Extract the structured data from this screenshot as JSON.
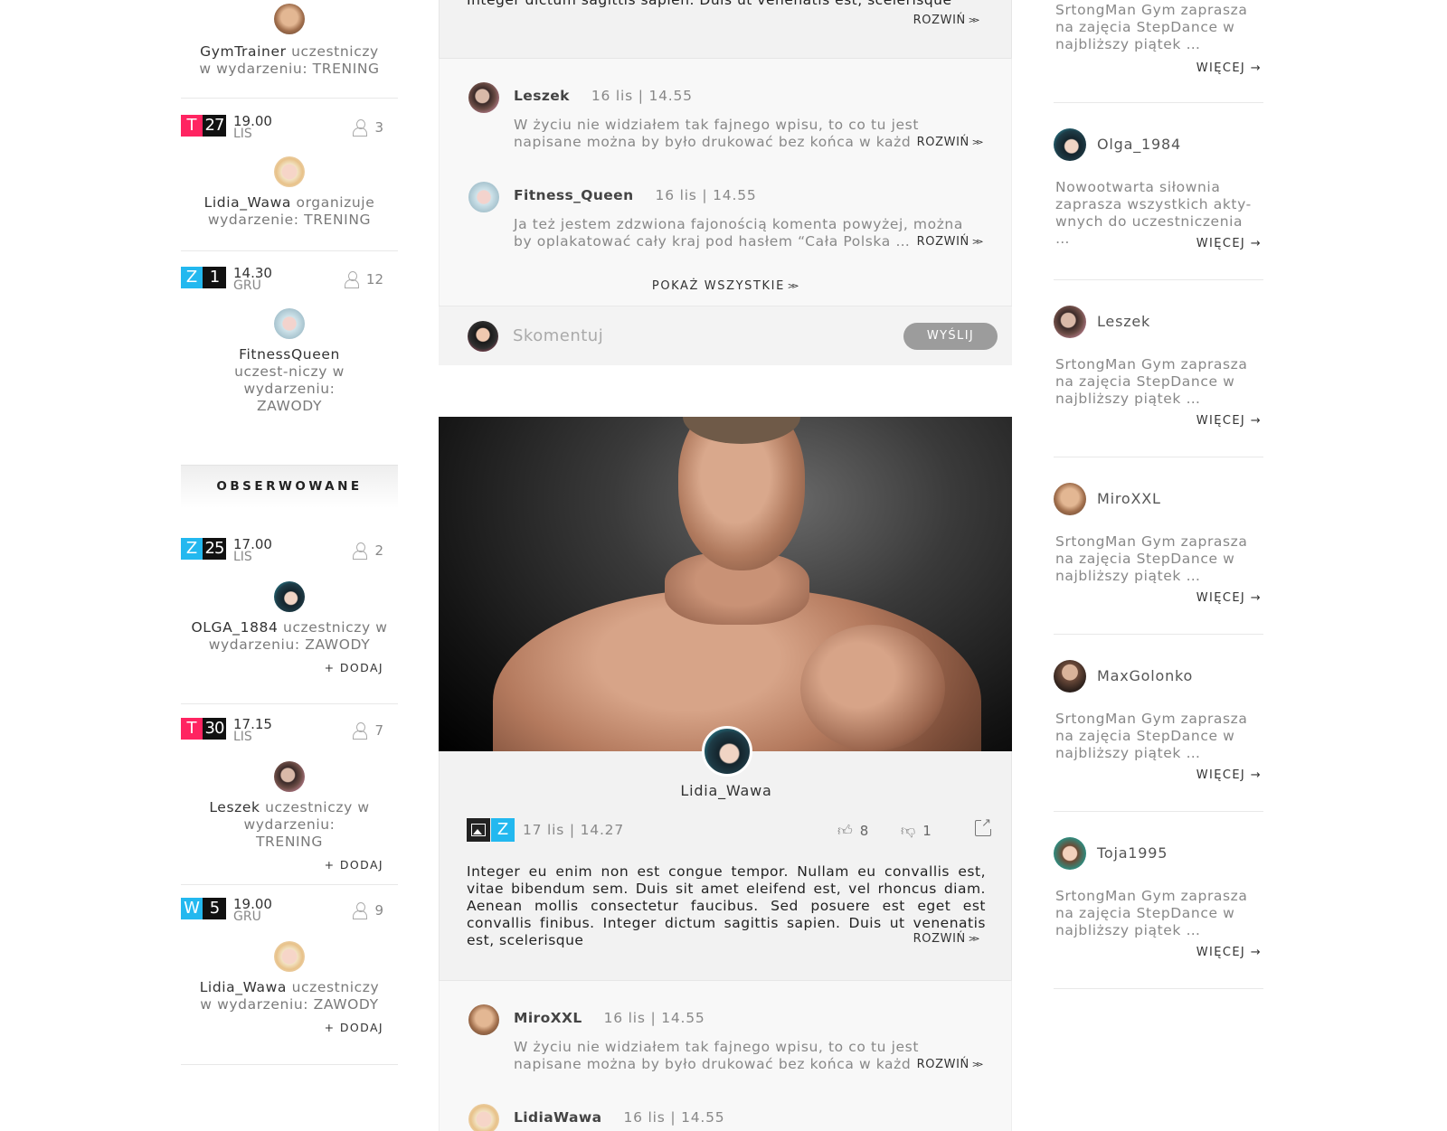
{
  "left": {
    "top_activity": {
      "user": "GymTrainer",
      "text": "uczestniczy w wydarzeniu: TRENING"
    },
    "events": [
      {
        "letter": "T",
        "day": "27",
        "time": "19.00",
        "month": "LIS",
        "count": "3",
        "user": "Lidia_Wawa",
        "text": "organizuje wydarzenie: TRENING"
      },
      {
        "letter": "Z",
        "day": "1",
        "time": "14.30",
        "month": "GRU",
        "count": "12",
        "user": "FitnessQueen",
        "text": "uczest-niczy w wydarzeniu: ZAWODY"
      }
    ],
    "observed_title": "OBSERWOWANE",
    "observed": [
      {
        "letter": "Z",
        "day": "25",
        "time": "17.00",
        "month": "LIS",
        "count": "2",
        "user": "OLGA_1884",
        "text": "uczestniczy w wydarzeniu: ZAWODY",
        "add": "+ DODAJ"
      },
      {
        "letter": "T",
        "day": "30",
        "time": "17.15",
        "month": "LIS",
        "count": "7",
        "user": "Leszek",
        "text": "uczestniczy w wydarzeniu: TRENING",
        "add": "+ DODAJ"
      },
      {
        "letter": "W",
        "day": "5",
        "time": "19.00",
        "month": "GRU",
        "count": "9",
        "user": "Lidia_Wawa",
        "text": "uczestniczy w wydarzeniu: ZAWODY",
        "add": "+ DODAJ"
      }
    ]
  },
  "post1": {
    "text_tail": "Integer dictum sagittis sapien. Duis ut venenatis est, scelerisque",
    "expand": "ROZWIŃ",
    "comments": [
      {
        "user": "Leszek",
        "date": "16 lis | 14.55",
        "text": "W życiu nie widziałem tak fajnego wpisu, to co tu jest napisane można by było drukować bez końca w każdej  …",
        "expand": "ROZWIŃ"
      },
      {
        "user": "Fitness_Queen",
        "date": "16 lis | 14.55",
        "text": "Ja też jestem zdzwiona fajonością komenta powyżej, można by oplakatować cały kraj pod hasłem “Cała Polska …",
        "expand": "ROZWIŃ"
      }
    ],
    "show_all": "POKAŻ WSZYSTKIE",
    "comment_placeholder": "Skomentuj",
    "send": "WYŚLIJ"
  },
  "post2": {
    "author": "Lidia_Wawa",
    "type_letter": "Z",
    "date": "17 lis | 14.27",
    "likes": "8",
    "dislikes": "1",
    "text": "Integer eu enim non est congue tempor. Nullam eu convallis est, vitae bibendum sem. Duis sit amet eleifend est, vel rhoncus diam. Aenean mollis consectetur faucibus. Sed posuere est eget est convallis finibus. Integer dictum sagittis sapien. Duis ut venenatis est, scelerisque",
    "expand": "ROZWIŃ",
    "comments": [
      {
        "user": "MiroXXL",
        "date": "16 lis | 14.55",
        "text": "W życiu nie widziałem tak fajnego wpisu, to co tu jest napisane można by było drukować bez końca w każdej  …",
        "expand": "ROZWIŃ"
      },
      {
        "user": "LidiaWawa",
        "date": "16 lis | 14.55"
      }
    ]
  },
  "right": {
    "top_desc": "SrtongMan Gym zaprasza na zajęcia StepDance w najbliższy piątek …",
    "more": "WIĘCEJ →",
    "items": [
      {
        "user": "Olga_1984",
        "desc": "Nowootwarta siłownia zaprasza wszystkich akty-wnych do uczestniczenia …"
      },
      {
        "user": "Leszek",
        "desc": "SrtongMan Gym zaprasza na zajęcia StepDance w najbliższy piątek …"
      },
      {
        "user": "MiroXXL",
        "desc": "SrtongMan Gym zaprasza na zajęcia StepDance w najbliższy piątek …"
      },
      {
        "user": "MaxGolonko",
        "desc": "SrtongMan Gym zaprasza na zajęcia StepDance w najbliższy piątek …"
      },
      {
        "user": "Toja1995",
        "desc": "SrtongMan Gym zaprasza na zajęcia StepDance w najbliższy piątek …"
      }
    ]
  },
  "colors": {
    "red": "#ff2461",
    "blue": "#23b8ef",
    "black": "#111111"
  }
}
